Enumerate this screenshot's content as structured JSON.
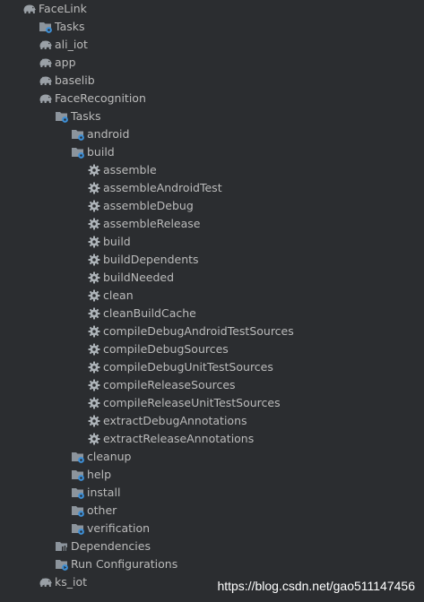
{
  "tree": [
    {
      "label": "FaceLink",
      "icon": "elephant-icon",
      "depth": 0,
      "expand": "open"
    },
    {
      "label": "Tasks",
      "icon": "task-folder-icon",
      "depth": 1,
      "expand": "closed"
    },
    {
      "label": "ali_iot",
      "icon": "elephant-icon",
      "depth": 1,
      "expand": "closed"
    },
    {
      "label": "app",
      "icon": "elephant-icon",
      "depth": 1,
      "expand": "closed"
    },
    {
      "label": "baselib",
      "icon": "elephant-icon",
      "depth": 1,
      "expand": "closed"
    },
    {
      "label": "FaceRecognition",
      "icon": "elephant-icon",
      "depth": 1,
      "expand": "open"
    },
    {
      "label": "Tasks",
      "icon": "task-folder-icon",
      "depth": 2,
      "expand": "open"
    },
    {
      "label": "android",
      "icon": "task-folder-icon",
      "depth": 3,
      "expand": "closed"
    },
    {
      "label": "build",
      "icon": "task-folder-icon",
      "depth": 3,
      "expand": "open"
    },
    {
      "label": "assemble",
      "icon": "gear-icon",
      "depth": 4,
      "expand": "none"
    },
    {
      "label": "assembleAndroidTest",
      "icon": "gear-icon",
      "depth": 4,
      "expand": "none"
    },
    {
      "label": "assembleDebug",
      "icon": "gear-icon",
      "depth": 4,
      "expand": "none"
    },
    {
      "label": "assembleRelease",
      "icon": "gear-icon",
      "depth": 4,
      "expand": "none"
    },
    {
      "label": "build",
      "icon": "gear-icon",
      "depth": 4,
      "expand": "none"
    },
    {
      "label": "buildDependents",
      "icon": "gear-icon",
      "depth": 4,
      "expand": "none"
    },
    {
      "label": "buildNeeded",
      "icon": "gear-icon",
      "depth": 4,
      "expand": "none"
    },
    {
      "label": "clean",
      "icon": "gear-icon",
      "depth": 4,
      "expand": "none"
    },
    {
      "label": "cleanBuildCache",
      "icon": "gear-icon",
      "depth": 4,
      "expand": "none"
    },
    {
      "label": "compileDebugAndroidTestSources",
      "icon": "gear-icon",
      "depth": 4,
      "expand": "none"
    },
    {
      "label": "compileDebugSources",
      "icon": "gear-icon",
      "depth": 4,
      "expand": "none"
    },
    {
      "label": "compileDebugUnitTestSources",
      "icon": "gear-icon",
      "depth": 4,
      "expand": "none"
    },
    {
      "label": "compileReleaseSources",
      "icon": "gear-icon",
      "depth": 4,
      "expand": "none"
    },
    {
      "label": "compileReleaseUnitTestSources",
      "icon": "gear-icon",
      "depth": 4,
      "expand": "none"
    },
    {
      "label": "extractDebugAnnotations",
      "icon": "gear-icon",
      "depth": 4,
      "expand": "none"
    },
    {
      "label": "extractReleaseAnnotations",
      "icon": "gear-icon",
      "depth": 4,
      "expand": "none"
    },
    {
      "label": "cleanup",
      "icon": "task-folder-icon",
      "depth": 3,
      "expand": "closed"
    },
    {
      "label": "help",
      "icon": "task-folder-icon",
      "depth": 3,
      "expand": "closed"
    },
    {
      "label": "install",
      "icon": "task-folder-icon",
      "depth": 3,
      "expand": "closed"
    },
    {
      "label": "other",
      "icon": "task-folder-icon",
      "depth": 3,
      "expand": "closed"
    },
    {
      "label": "verification",
      "icon": "task-folder-icon",
      "depth": 3,
      "expand": "closed"
    },
    {
      "label": "Dependencies",
      "icon": "dependencies-icon",
      "depth": 2,
      "expand": "closed"
    },
    {
      "label": "Run Configurations",
      "icon": "run-config-folder-icon",
      "depth": 2,
      "expand": "closed"
    },
    {
      "label": "ks_iot",
      "icon": "elephant-icon",
      "depth": 1,
      "expand": "closed"
    }
  ],
  "watermark": "https://blog.csdn.net/gao511147456",
  "colors": {
    "background": "#2b2d30",
    "text": "#bbbbbb",
    "arrow": "#a9b0b7",
    "elephant": "#9aa0a6",
    "folder": "#8c949c",
    "gear": "#adb3b8",
    "accent": "#3d8fd6"
  }
}
